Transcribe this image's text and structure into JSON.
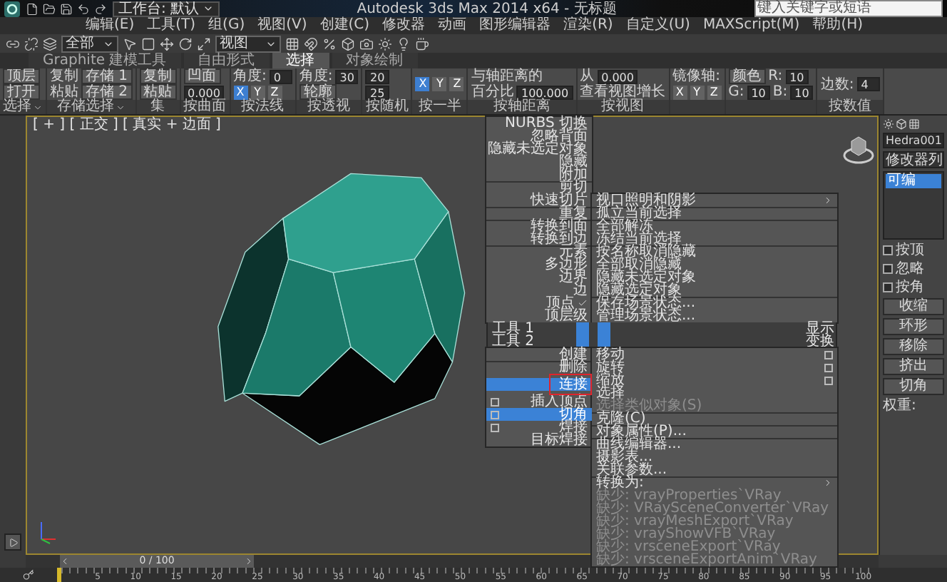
{
  "title_bar": {
    "workspace": "工作台: 默认",
    "title": "Autodesk 3ds Max 2014 x64 - 无标题",
    "search": {
      "placeholder": "键入关键字或短语"
    }
  },
  "menu_bar": [
    "编辑(E)",
    "工具(T)",
    "组(G)",
    "视图(V)",
    "创建(C)",
    "修改器",
    "动画",
    "图形编辑器",
    "渲染(R)",
    "自定义(U)",
    "MAXScript(M)",
    "帮助(H)"
  ],
  "toolbar": {
    "selection_filter": "全部",
    "reference_coord": "视图"
  },
  "ribbon_tabs": [
    {
      "label": "Graphite 建模工具",
      "selected": false
    },
    {
      "label": "自由形式",
      "selected": false
    },
    {
      "label": "选择",
      "selected": true
    },
    {
      "label": "对象绘制",
      "selected": false
    }
  ],
  "ribbon_groups": [
    {
      "label": "选择",
      "menu": true,
      "lines": [
        {
          "items": [
            {
              "kind": "button",
              "text": "顶层"
            }
          ]
        },
        {
          "items": [
            {
              "kind": "button",
              "text": "打开"
            }
          ]
        }
      ]
    },
    {
      "label": "存储选择",
      "menu": true,
      "lines": [
        {
          "items": [
            {
              "kind": "text",
              "text": "复制"
            },
            {
              "kind": "button",
              "text": "存储 1"
            }
          ]
        },
        {
          "items": [
            {
              "kind": "text",
              "text": "粘贴"
            },
            {
              "kind": "button",
              "text": "存储 2"
            }
          ]
        }
      ]
    },
    {
      "label": "集",
      "menu": false,
      "lines": [
        {
          "items": [
            {
              "kind": "button",
              "text": "复制"
            }
          ]
        },
        {
          "items": [
            {
              "kind": "button",
              "text": "粘贴"
            }
          ]
        }
      ]
    },
    {
      "label": "按曲面",
      "menu": false,
      "lines": [
        {
          "items": [
            {
              "kind": "button",
              "text": "凹面"
            }
          ]
        },
        {
          "items": [
            {
              "kind": "field",
              "text": "0.000"
            }
          ]
        }
      ]
    },
    {
      "label": "按法线",
      "menu": false,
      "lines": [
        {
          "items": [
            {
              "kind": "text",
              "text": "角度:"
            },
            {
              "kind": "field",
              "text": "0"
            }
          ]
        },
        {
          "items": [
            {
              "kind": "toggle",
              "text": "X",
              "selected": true
            },
            {
              "kind": "toggle",
              "text": "Y",
              "selected": false
            },
            {
              "kind": "toggle",
              "text": "Z",
              "selected": false
            }
          ]
        }
      ]
    },
    {
      "label": "按透视",
      "menu": false,
      "lines": [
        {
          "items": [
            {
              "kind": "text",
              "text": "角度:"
            },
            {
              "kind": "field",
              "text": "30"
            }
          ]
        },
        {
          "items": [
            {
              "kind": "button",
              "text": "轮廓"
            }
          ]
        }
      ]
    },
    {
      "label": "按随机",
      "menu": false,
      "lines": [
        {
          "items": [
            {
              "kind": "field",
              "text": "20"
            }
          ]
        },
        {
          "items": [
            {
              "kind": "field",
              "text": "25"
            }
          ]
        }
      ]
    },
    {
      "label": "按一半",
      "menu": false,
      "lines": [
        {
          "items": [
            {
              "kind": "toggle",
              "text": "X",
              "selected": true
            },
            {
              "kind": "toggle",
              "text": "Y",
              "selected": false
            },
            {
              "kind": "toggle",
              "text": "Z",
              "selected": false
            }
          ]
        }
      ]
    },
    {
      "label": "按轴距离",
      "menu": false,
      "lines": [
        {
          "items": [
            {
              "kind": "text",
              "text": "与轴距离的"
            }
          ]
        },
        {
          "items": [
            {
              "kind": "text",
              "text": "百分比"
            },
            {
              "kind": "field",
              "text": "100.000"
            }
          ]
        }
      ]
    },
    {
      "label": "按视图",
      "menu": false,
      "lines": [
        {
          "items": [
            {
              "kind": "text",
              "text": "从"
            },
            {
              "kind": "field",
              "text": "0.000"
            }
          ]
        },
        {
          "items": [
            {
              "kind": "text",
              "text": "查看视图增长"
            }
          ]
        }
      ]
    },
    {
      "menu": false,
      "lines": [
        {
          "items": [
            {
              "kind": "text",
              "text": "镜像轴:"
            }
          ]
        },
        {
          "items": [
            {
              "kind": "toggle",
              "text": "X",
              "selected": false
            },
            {
              "kind": "toggle",
              "text": "Y",
              "selected": false
            },
            {
              "kind": "toggle",
              "text": "Z",
              "selected": false
            }
          ]
        }
      ]
    },
    {
      "menu": false,
      "lines": [
        {
          "items": [
            {
              "kind": "button",
              "text": "颜色"
            },
            {
              "kind": "text",
              "text": "R:"
            },
            {
              "kind": "field",
              "text": "10"
            }
          ]
        },
        {
          "items": [
            {
              "kind": "text",
              "text": "G:"
            },
            {
              "kind": "field",
              "text": "10"
            },
            {
              "kind": "text",
              "text": "B:"
            },
            {
              "kind": "field",
              "text": "10"
            }
          ]
        }
      ]
    },
    {
      "label": "按数值",
      "menu": false,
      "lines": [
        {
          "items": [
            {
              "kind": "text",
              "text": "边数:"
            },
            {
              "kind": "field",
              "text": "4"
            }
          ]
        }
      ]
    }
  ],
  "viewport": {
    "label": "[ + ] [ 正交 ] [ 真实 + 边面 ]"
  },
  "quad_menu": {
    "top_left": [
      [
        {
          "label": "NURBS 切换",
          "checked": false
        },
        {
          "label": "忽略背面",
          "checked": false
        },
        {
          "label": "隐藏未选定对象",
          "checked": false
        },
        {
          "label": "隐藏",
          "checked": false
        },
        {
          "label": "附加",
          "checked": false
        }
      ],
      [
        {
          "label": "剪切",
          "checked": false
        },
        {
          "label": "快速切片",
          "checked": false
        }
      ],
      [
        {
          "label": "重复",
          "checked": false
        }
      ],
      [
        {
          "label": "转换到面",
          "checked": false
        },
        {
          "label": "转换到边",
          "checked": false
        }
      ],
      [
        {
          "label": "元素",
          "checked": false
        },
        {
          "label": "多边形",
          "checked": false
        },
        {
          "label": "边界",
          "checked": false
        },
        {
          "label": "边",
          "checked": false
        },
        {
          "label": "顶点",
          "checked": true
        },
        {
          "label": "顶层级",
          "checked": false
        }
      ]
    ],
    "top_right": [
      [
        {
          "label": "视口照明和阴影",
          "submenu": true
        }
      ],
      [
        {
          "label": "孤立当前选择",
          "submenu": false
        }
      ],
      [
        {
          "label": "全部解冻",
          "submenu": false
        },
        {
          "label": "冻结当前选择",
          "submenu": false
        }
      ],
      [
        {
          "label": "按名称取消隐藏",
          "submenu": false
        },
        {
          "label": "全部取消隐藏",
          "submenu": false
        },
        {
          "label": "隐藏未选定对象",
          "submenu": false
        },
        {
          "label": "隐藏选定对象",
          "submenu": false
        }
      ],
      [
        {
          "label": "保存场景状态...",
          "submenu": false
        },
        {
          "label": "管理场景状态...",
          "submenu": false
        }
      ]
    ],
    "headers": [
      {
        "left": "工具 1",
        "right": "显示"
      },
      {
        "left": "工具 2",
        "right": "变换"
      }
    ],
    "bottom_left": [
      [
        {
          "label": "创建",
          "selected": false,
          "marked": false,
          "options": false
        }
      ],
      [
        {
          "label": "删除",
          "selected": false,
          "marked": false,
          "options": false
        }
      ],
      [
        {
          "label": "连接",
          "selected": true,
          "marked": true,
          "options": false
        },
        {
          "label": "插入顶点",
          "selected": false,
          "marked": false,
          "options": true
        },
        {
          "label": "切角",
          "selected": true,
          "marked": false,
          "options": true
        },
        {
          "label": "焊接",
          "selected": false,
          "marked": false,
          "options": true
        },
        {
          "label": "目标焊接",
          "selected": false,
          "marked": false,
          "options": false
        }
      ]
    ],
    "bottom_right": [
      [
        {
          "label": "移动",
          "disabled": false,
          "submenu": false,
          "options": true
        },
        {
          "label": "旋转",
          "disabled": false,
          "submenu": false,
          "options": true
        },
        {
          "label": "缩放",
          "disabled": false,
          "submenu": false,
          "options": true
        },
        {
          "label": "选择",
          "disabled": false,
          "submenu": false,
          "options": false
        },
        {
          "label": "选择类似对象(S)",
          "disabled": true,
          "submenu": false,
          "options": false
        }
      ],
      [
        {
          "label": "克隆(C)",
          "disabled": false,
          "submenu": false,
          "options": false
        }
      ],
      [
        {
          "label": "对象属性(P)...",
          "disabled": false,
          "submenu": false,
          "options": false
        }
      ],
      [
        {
          "label": "曲线编辑器...",
          "disabled": false,
          "submenu": false,
          "options": false
        },
        {
          "label": "摄影表...",
          "disabled": false,
          "submenu": false,
          "options": false
        },
        {
          "label": "关联参数...",
          "disabled": false,
          "submenu": false,
          "options": false
        }
      ],
      [
        {
          "label": "转换为:",
          "disabled": false,
          "submenu": true,
          "options": false
        },
        {
          "label": "缺少: vrayProperties`VRay",
          "disabled": true,
          "submenu": false,
          "options": false
        },
        {
          "label": "缺少: VRaySceneConverter`VRay",
          "disabled": true,
          "submenu": false,
          "options": false
        },
        {
          "label": "缺少: vrayMeshExport`VRay",
          "disabled": true,
          "submenu": false,
          "options": false
        },
        {
          "label": "缺少: vrayShowVFB`VRay",
          "disabled": true,
          "submenu": false,
          "options": false
        },
        {
          "label": "缺少: vrsceneExport`VRay",
          "disabled": true,
          "submenu": false,
          "options": false
        },
        {
          "label": "缺少: vrsceneExportAnim`VRay",
          "disabled": true,
          "submenu": false,
          "options": false
        }
      ]
    ]
  },
  "command_panel": {
    "object_name": "Hedra001",
    "modifier_list": "修改器列",
    "stack": [
      {
        "label": "可编",
        "selected": true
      }
    ],
    "checkboxes": [
      {
        "label": "按顶",
        "checked": false
      },
      {
        "label": "忽略",
        "checked": false
      },
      {
        "label": "按角",
        "checked": false
      }
    ],
    "buttons": [
      "收缩",
      "环形",
      "移除",
      "挤出",
      "切角"
    ],
    "weight_label": "权重:"
  },
  "time_slider": {
    "reading": "0 / 100"
  },
  "ruler": [
    "5",
    "10",
    "15",
    "20",
    "25",
    "30",
    "35",
    "40",
    "45",
    "50",
    "55",
    "60",
    "65",
    "70",
    "75",
    "80",
    "85",
    "90",
    "95",
    "100"
  ]
}
